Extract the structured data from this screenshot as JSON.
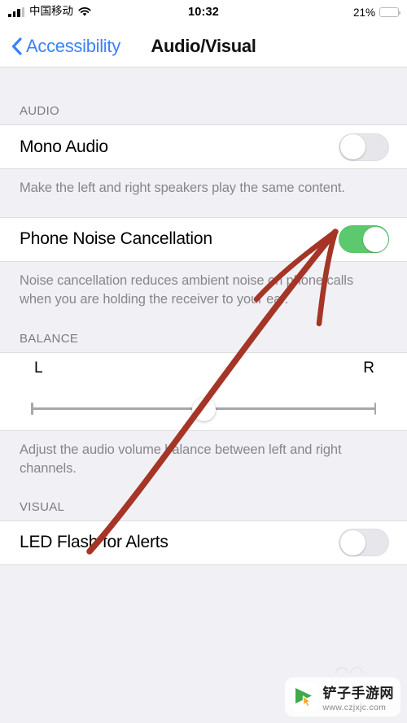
{
  "status_bar": {
    "carrier": "中国移动",
    "signal_icon": "cellular-signal-icon",
    "wifi_icon": "wifi-icon",
    "time": "10:32",
    "battery_percent": "21%",
    "battery_level": 21,
    "battery_color": "#ffcc00"
  },
  "nav": {
    "back_label": "Accessibility",
    "back_icon": "chevron-left-icon",
    "title": "Audio/Visual",
    "tint_color": "#3b82f6"
  },
  "sections": {
    "audio": {
      "header": "AUDIO",
      "rows": [
        {
          "label": "Mono Audio",
          "toggle_state": "off",
          "footnote": "Make the left and right speakers play the same content."
        },
        {
          "label": "Phone Noise Cancellation",
          "toggle_state": "on",
          "footnote": "Noise cancellation reduces ambient noise on phone calls when you are holding the receiver to your ear."
        }
      ]
    },
    "balance": {
      "header": "BALANCE",
      "left_label": "L",
      "right_label": "R",
      "value_percent": 50,
      "footnote": "Adjust the audio volume balance between left and right channels."
    },
    "visual": {
      "header": "VISUAL",
      "rows": [
        {
          "label": "LED Flash for Alerts",
          "toggle_state": "off"
        }
      ]
    }
  },
  "annotation": {
    "color": "#a53526",
    "shape": "hand-drawn-arrow-pointing-to-noise-cancellation-toggle"
  },
  "watermark": {
    "site_name": "铲子手游网",
    "url": "www.czjxjc.com",
    "logo_icon": "play-cursor-logo-icon"
  },
  "colors": {
    "toggle_on": "#5dc96f",
    "toggle_off": "#e6e6eb",
    "page_background": "#f1f1f5",
    "row_background": "#ffffff",
    "footnote_text": "#86868b"
  }
}
